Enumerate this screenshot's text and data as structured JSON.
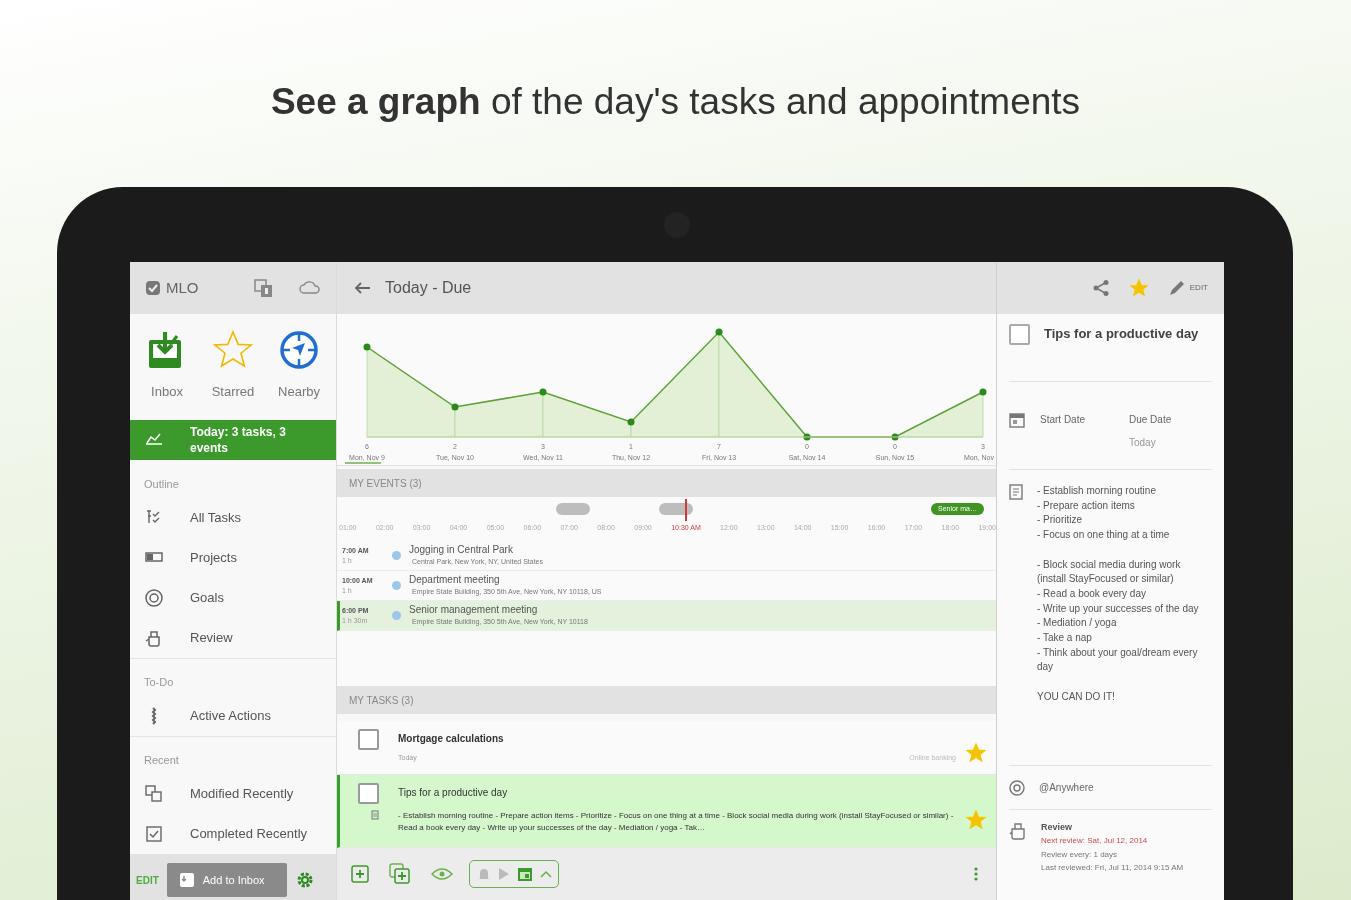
{
  "headline": "**See a graph** of the day's tasks and appointments",
  "sidebar": {
    "app_name": "MLO",
    "quick": [
      {
        "label": "Inbox"
      },
      {
        "label": "Starred"
      },
      {
        "label": "Nearby"
      }
    ],
    "items": [
      {
        "kind": "item",
        "label": "Today: 3 tasks, 3 events",
        "selected": true
      },
      {
        "kind": "heading",
        "label": "Outline"
      },
      {
        "kind": "item",
        "label": "All Tasks",
        "selected": false
      },
      {
        "kind": "item",
        "label": "Projects",
        "selected": false
      },
      {
        "kind": "item",
        "label": "Goals",
        "selected": false
      },
      {
        "kind": "item",
        "label": "Review",
        "selected": false
      },
      {
        "kind": "heading",
        "label": "To-Do"
      },
      {
        "kind": "item",
        "label": "Active Actions",
        "selected": false
      },
      {
        "kind": "heading",
        "label": "Recent"
      },
      {
        "kind": "item",
        "label": "Modified Recently",
        "selected": false
      },
      {
        "kind": "item",
        "label": "Completed Recently",
        "selected": false
      }
    ],
    "edit_label": "EDIT",
    "add_button": "Add to Inbox"
  },
  "main": {
    "title": "Today - Due",
    "chart_data": {
      "type": "area",
      "categories": [
        "Mon, Nov 9",
        "Tue, Nov 10",
        "Wed, Nov 11",
        "Thu, Nov 12",
        "Fri, Nov 13",
        "Sat, Nov 14",
        "Sun, Nov 15",
        "Mon, Nov"
      ],
      "values": [
        6,
        2,
        3,
        1,
        7,
        0,
        0,
        3
      ],
      "data_labels": true
    },
    "events_header": "MY EVENTS (3)",
    "hours": [
      {
        "label": "01:00",
        "current": false
      },
      {
        "label": "02:00",
        "current": false
      },
      {
        "label": "03:00",
        "current": false
      },
      {
        "label": "04:00",
        "current": false
      },
      {
        "label": "05:00",
        "current": false
      },
      {
        "label": "06:00",
        "current": false
      },
      {
        "label": "07:00",
        "current": false
      },
      {
        "label": "08:00",
        "current": false
      },
      {
        "label": "09:00",
        "current": false
      },
      {
        "label": "10:30 AM",
        "current": true
      },
      {
        "label": "12:00",
        "current": false
      },
      {
        "label": "13:00",
        "current": false
      },
      {
        "label": "14:00",
        "current": false
      },
      {
        "label": "15:00",
        "current": false
      },
      {
        "label": "16:00",
        "current": false
      },
      {
        "label": "17:00",
        "current": false
      },
      {
        "label": "18:00",
        "current": false
      },
      {
        "label": "19:00",
        "current": false
      }
    ],
    "events": [
      {
        "time": "7:00 AM",
        "duration": "1 h",
        "title": "Jogging in Central Park",
        "location": "Central Park, New York, NY, United States",
        "selected": false
      },
      {
        "time": "10:00 AM",
        "duration": "1 h",
        "title": "Department meeting",
        "location": "Empire State Building, 350 5th Ave, New York, NY 10118, US",
        "selected": false
      },
      {
        "time": "6:00 PM",
        "duration": "1 h 30m",
        "title": "Senior management meeting",
        "location": "Empire State Building, 350 5th Ave, New York, NY 10118",
        "selected": true,
        "timeline_label": "Senior ma…"
      }
    ],
    "tasks_header": "MY TASKS (3)",
    "tasks": [
      {
        "title": "Mortgage calculations",
        "subtitle": "Today",
        "context": "Online banking",
        "checked": false,
        "starred": true,
        "selected": false
      },
      {
        "title": "Tips for a productive day",
        "note": "- Establish morning routine - Prepare action items - Prioritize - Focus on one thing at a time - Block social media during work (install StayFocused or similar) - Read a book every day - Write up your successes of the day - Mediation / yoga - Tak…",
        "checked": false,
        "starred": true,
        "selected": true
      }
    ]
  },
  "detail": {
    "edit_label": "EDIT",
    "starred": true,
    "title": "Tips for a productive day",
    "checked": false,
    "start_label": "Start Date",
    "due_label": "Due Date",
    "due_value": "Today",
    "note": "- Establish morning routine\n- Prepare action items\n- Prioritize\n- Focus on one thing at a time\n\n- Block social media during work (install StayFocused or similar)\n- Read a book every day\n- Write up your successes of the day\n- Mediation / yoga\n- Take a nap\n- Think about your goal/dream every day\n\nYOU CAN DO IT!",
    "context": "@Anywhere",
    "review_title": "Review",
    "next_review": "Next review: Sat, Jul 12, 2014",
    "review_every": "Review every: 1 days",
    "last_reviewed": "Last reviewed: Fri, Jul 11, 2014 9:15 AM"
  }
}
